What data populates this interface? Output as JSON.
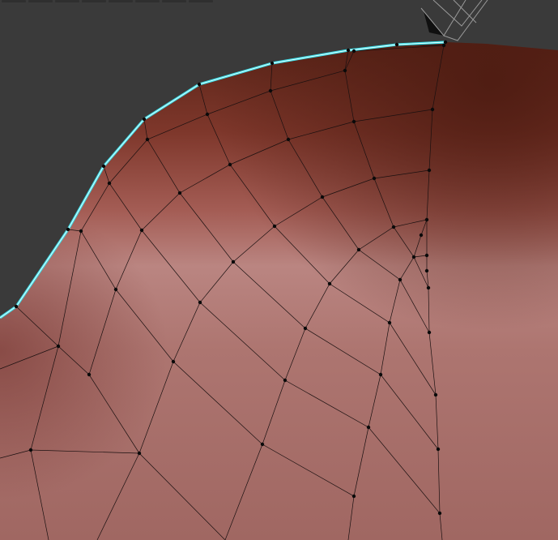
{
  "viewport": {
    "name": "3d-viewport",
    "mode": "edit-mode",
    "object": "mesh-surface"
  },
  "colors": {
    "background": "#3a3a3a",
    "surface_dark": "#5e2519",
    "surface_mid": "#9a4d45",
    "surface_light": "#b8807c",
    "surface_base": "#a8706a",
    "wire": "#1a1010",
    "vertex": "#0a0a0a",
    "selected_edge": "#3fe0ea",
    "camera_gizmo": "#1c1c1c"
  },
  "icons": {
    "camera": "camera-gizmo-icon"
  }
}
